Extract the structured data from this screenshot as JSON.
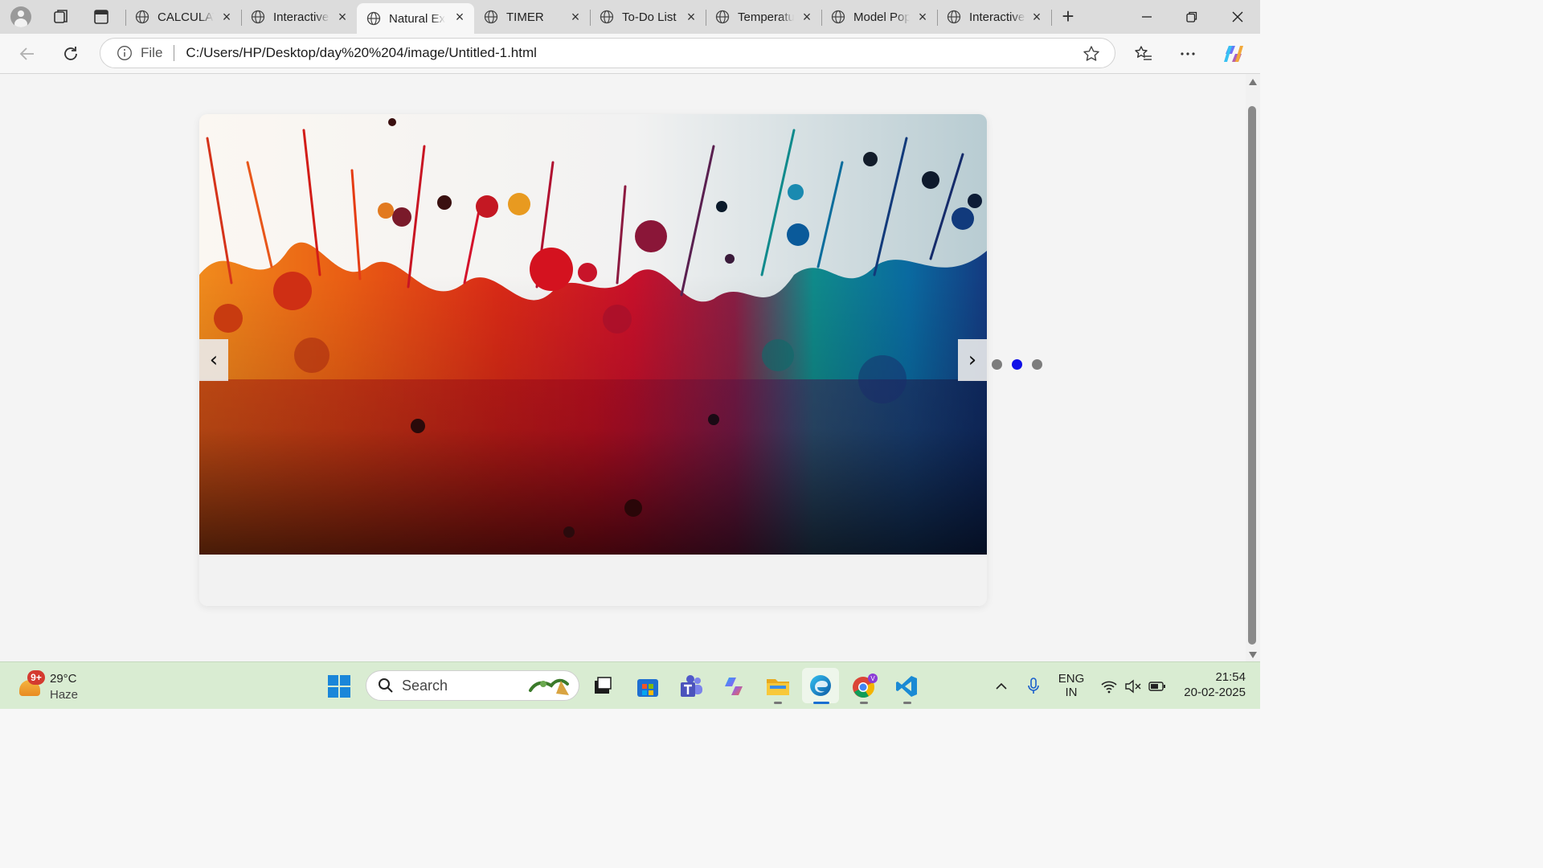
{
  "browser": {
    "tabs": [
      {
        "title": "CALCULATOR",
        "active": false
      },
      {
        "title": "Interactive",
        "active": false
      },
      {
        "title": "Natural Experience",
        "active": true
      },
      {
        "title": "TIMER",
        "active": false
      },
      {
        "title": "To-Do List",
        "active": false
      },
      {
        "title": "Temperature",
        "active": false
      },
      {
        "title": "Model Popup",
        "active": false
      },
      {
        "title": "Interactive",
        "active": false
      }
    ],
    "address": {
      "scheme_label": "File",
      "url": "C:/Users/HP/Desktop/day%20%204/image/Untitled-1.html"
    }
  },
  "slider": {
    "prev_label": "‹",
    "next_label": "›",
    "dot_count": 3,
    "active_dot": 2,
    "image_description": "colorful paint splash"
  },
  "taskbar": {
    "weather": {
      "badge": "9+",
      "temperature": "29°C",
      "condition": "Haze"
    },
    "search_placeholder": "Search",
    "language": {
      "line1": "ENG",
      "line2": "IN"
    },
    "clock": {
      "time": "21:54",
      "date": "20-02-2025"
    }
  },
  "colors": {
    "active_dot": "#1010e8",
    "inactive_dot": "#7d7d7d",
    "taskbar_bg": "#d9ecd2",
    "tabstrip_bg": "#dcdcdc"
  }
}
